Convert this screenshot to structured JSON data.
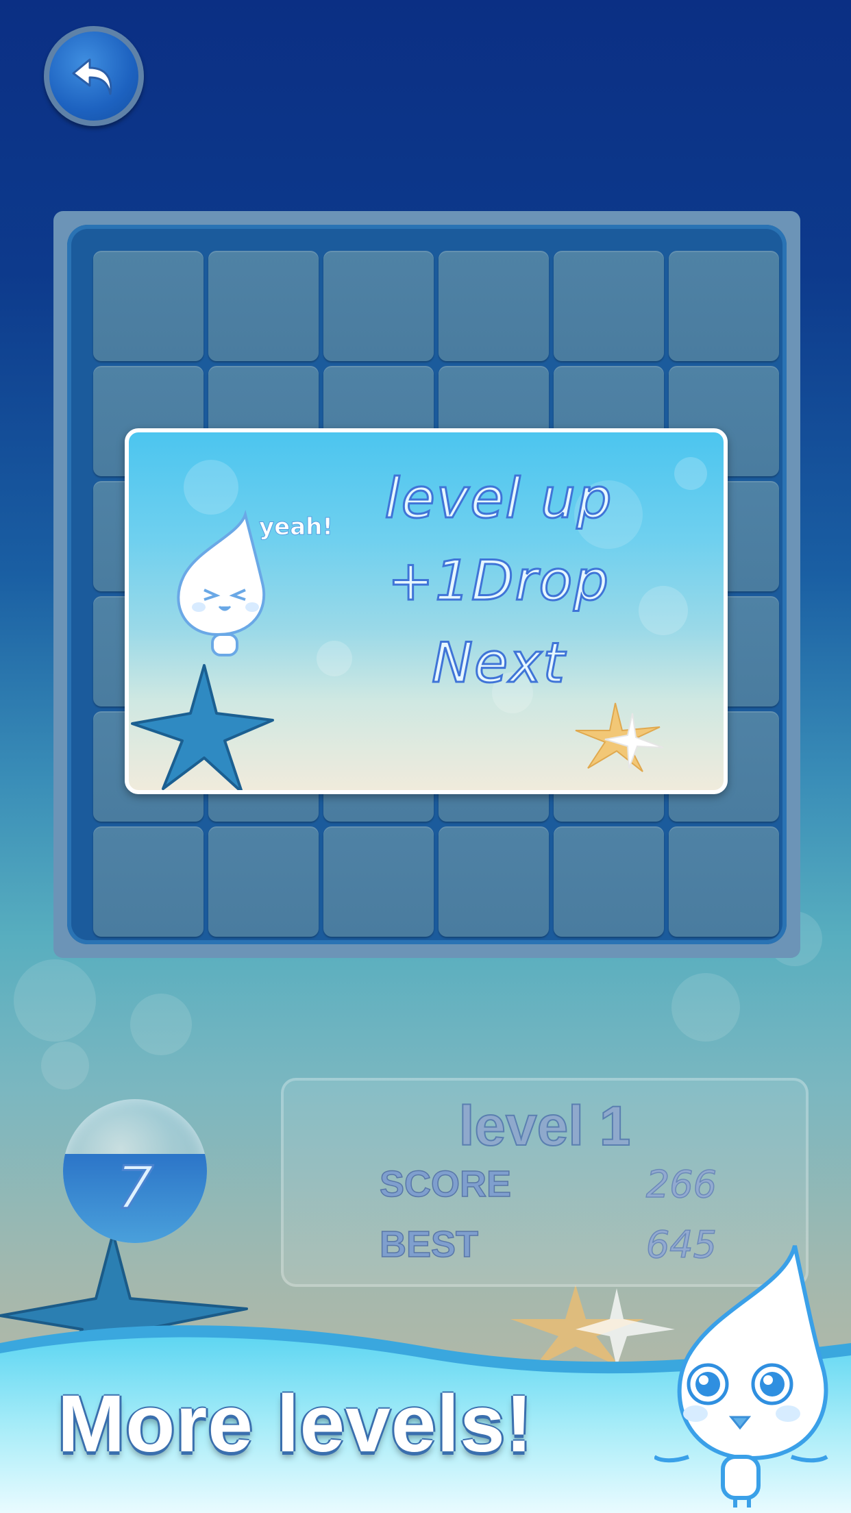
{
  "dialog": {
    "yeah": "yeah!",
    "title": "level up",
    "reward": "+1Drop",
    "next": "Next"
  },
  "moves": {
    "count": "7"
  },
  "info": {
    "level": "level 1",
    "score_label": "SCORE",
    "score_value": "266",
    "best_label": "BEST",
    "best_value": "645"
  },
  "banner": {
    "text": "More levels!"
  },
  "colors": {
    "board_frame": "#6c94b7",
    "tile": "#4f82a5",
    "dialog_text_stroke": "#3f74d7"
  }
}
